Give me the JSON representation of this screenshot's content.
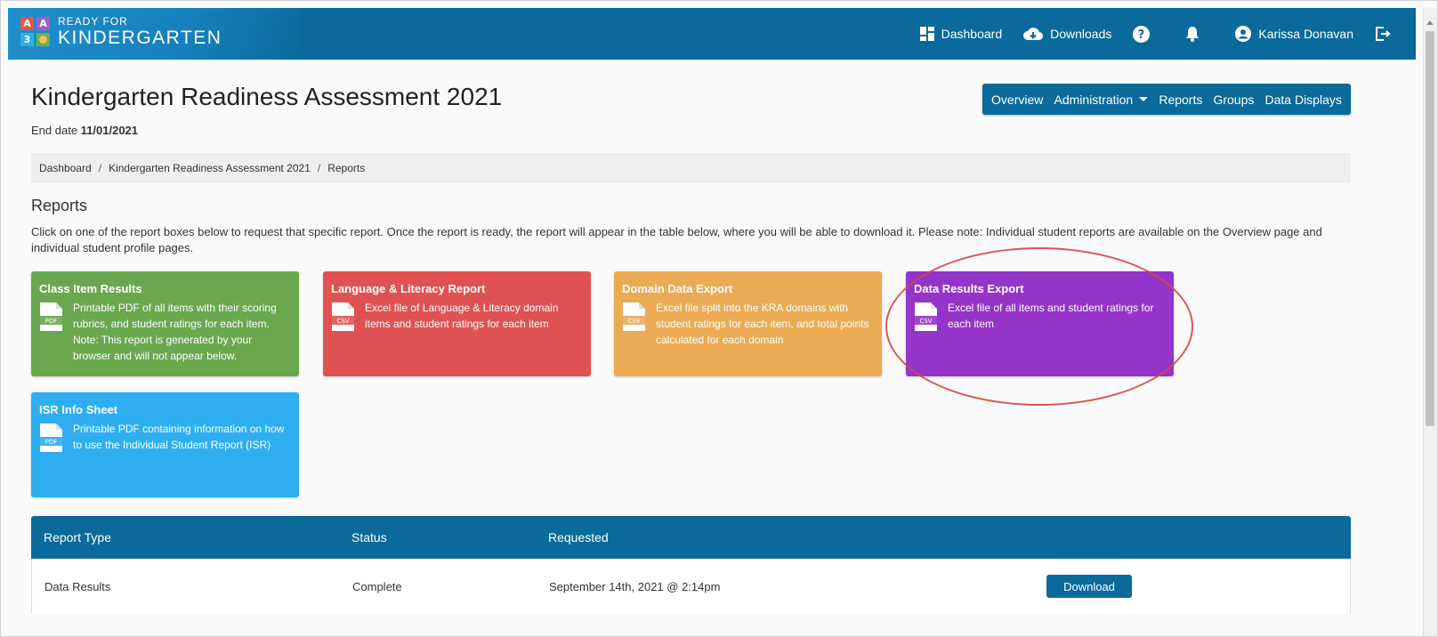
{
  "app": {
    "logo_top": "READY FOR",
    "logo_bottom": "KINDERGARTEN",
    "logo_blocks": [
      "A",
      "A",
      "3",
      ""
    ]
  },
  "topnav": {
    "dashboard": "Dashboard",
    "downloads": "Downloads",
    "user_name": "Karissa Donavan"
  },
  "page": {
    "title": "Kindergarten Readiness Assessment 2021",
    "end_date_label": "End date",
    "end_date_value": "11/01/2021"
  },
  "subnav": {
    "items": [
      "Overview",
      "Administration",
      "Reports",
      "Groups",
      "Data Displays"
    ]
  },
  "breadcrumb": {
    "items": [
      "Dashboard",
      "Kindergarten Readiness Assessment 2021",
      "Reports"
    ]
  },
  "reports": {
    "heading": "Reports",
    "intro": "Click on one of the report boxes below to request that specific report. Once the report is ready, the report will appear in the table below, where you will be able to download it. Please note: Individual student reports are available on the Overview page and individual student profile pages.",
    "cards": [
      {
        "title": "Class Item Results",
        "file_type": "PDF",
        "desc": "Printable PDF of all items with their scoring rubrics, and student ratings for each item. Note: This report is generated by your browser and will not appear below.",
        "color": "#6aa84f"
      },
      {
        "title": "Language & Literacy Report",
        "file_type": "CSV",
        "desc": "Excel file of Language & Literacy domain items and student ratings for each item",
        "color": "#e05252"
      },
      {
        "title": "Domain Data Export",
        "file_type": "CSV",
        "desc": "Excel file split into the KRA domains with student ratings for each item, and total points calculated for each domain",
        "color": "#ebab55"
      },
      {
        "title": "Data Results Export",
        "file_type": "CSV",
        "desc": "Excel file of all items and student ratings for each item",
        "color": "#9534c9"
      },
      {
        "title": "ISR Info Sheet",
        "file_type": "PDF",
        "desc": "Printable PDF containing information on how to use the Individual Student Report (ISR)",
        "color": "#2eaef0"
      }
    ]
  },
  "table": {
    "headers": [
      "Report Type",
      "Status",
      "Requested"
    ],
    "rows": [
      {
        "type": "Data Results",
        "status": "Complete",
        "requested": "September 14th, 2021 @ 2:14pm",
        "action": "Download"
      }
    ]
  },
  "icons": [
    "dashboard-icon",
    "cloud-download-icon",
    "help-icon",
    "bell-icon",
    "user-icon",
    "logout-icon",
    "pdf-file-icon",
    "csv-file-icon"
  ],
  "colors": {
    "primary": "#0a6a9b",
    "highlight_ring": "#d74545"
  }
}
